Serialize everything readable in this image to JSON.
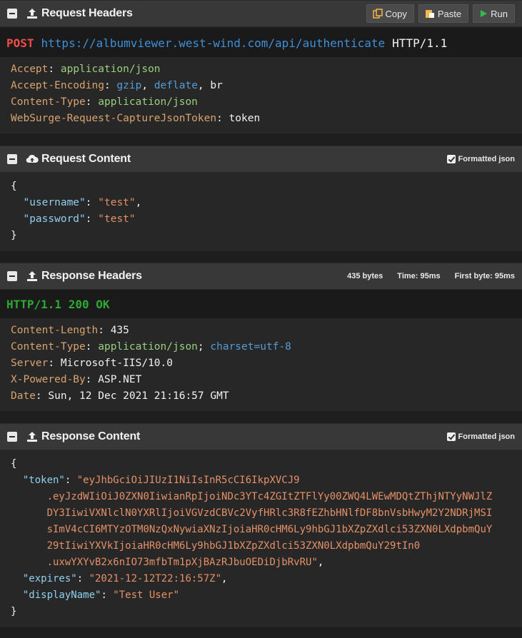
{
  "request_headers": {
    "title": "Request Headers",
    "copy_label": "Copy",
    "paste_label": "Paste",
    "run_label": "Run",
    "method": "POST",
    "url": "https://albumviewer.west-wind.com/api/authenticate",
    "protocol": "HTTP/1.1",
    "headers": [
      {
        "name": "Accept",
        "value": "application/json"
      },
      {
        "name": "Accept-Encoding",
        "value1": "gzip",
        "sep1": ", ",
        "value2": "deflate",
        "sep2": ", ",
        "value3": "br"
      },
      {
        "name": "Content-Type",
        "value": "application/json"
      },
      {
        "name": "WebSurge-Request-CaptureJsonToken",
        "value": "token"
      }
    ]
  },
  "request_content": {
    "title": "Request Content",
    "formatted_label": "Formatted json",
    "lines": [
      "{",
      "\"username\"",
      ": ",
      "\"test\"",
      ",",
      "\"password\"",
      ": ",
      "\"test\"",
      "}"
    ]
  },
  "response_headers": {
    "title": "Response Headers",
    "bytes": "435 bytes",
    "time": "Time: 95ms",
    "first_byte": "First byte: 95ms",
    "status": "HTTP/1.1 200 OK",
    "headers": [
      {
        "name": "Content-Length",
        "value": "435"
      },
      {
        "name": "Content-Type",
        "value": "application/json",
        "sep": "; ",
        "extra": "charset=utf-8"
      },
      {
        "name": "Server",
        "value": "Microsoft-IIS/10.0"
      },
      {
        "name": "X-Powered-By",
        "value": "ASP.NET"
      },
      {
        "name": "Date",
        "value": "Sun, 12 Dec 2021 21:16:57 GMT"
      }
    ]
  },
  "response_content": {
    "title": "Response Content",
    "formatted_label": "Formatted json",
    "token_key": "\"token\"",
    "token_lines": [
      "\"eyJhbGciOiJIUzI1NiIsInR5cCI6IkpXVCJ9",
      ".eyJzdWIiOiJ0ZXN0IiwianRpIjoiNDc3YTc4ZGItZTFlYy00ZWQ4LWEwMDQtZThjNTYyNWJlZ",
      "DY3IiwiVXNlclN0YXRlIjoiVGVzdCBVc2VyfHRlc3R8fEZhbHNlfDF8bnVsbHwyM2Y2NDRjMSI",
      "sImV4cCI6MTYzOTM0NzQxNywiaXNzIjoiaHR0cHM6Ly9hbGJ1bXZpZXdlci53ZXN0LXdpbmQuY",
      "29tIiwiYXVkIjoiaHR0cHM6Ly9hbGJ1bXZpZXdlci53ZXN0LXdpbmQuY29tIn0",
      ".uxwYXYvB2x6nIO73mfbTm1pXjBAzRJbuOEDiDjbRvRU\""
    ],
    "expires_key": "\"expires\"",
    "expires_value": "\"2021-12-12T22:16:57Z\"",
    "display_key": "\"displayName\"",
    "display_value": "\"Test User\""
  },
  "colors": {
    "accent_red": "#f14c4c",
    "accent_green": "#2fa833",
    "url_blue": "#3f8fd9"
  }
}
